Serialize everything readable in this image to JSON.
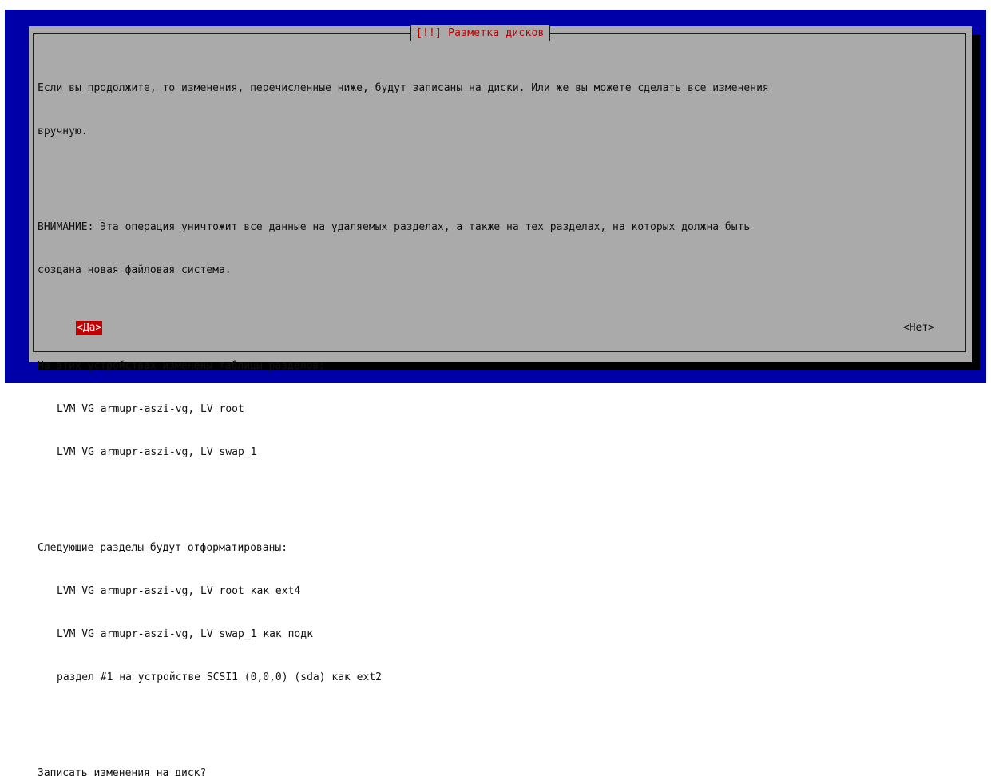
{
  "dialog": {
    "title": "[!!] Разметка дисков",
    "intro_lines": [
      "Если вы продолжите, то изменения, перечисленные ниже, будут записаны на диски. Или же вы можете сделать все изменения",
      "вручную."
    ],
    "warning_lines": [
      "ВНИМАНИЕ: Эта операция уничтожит все данные на удаляемых разделах, а также на тех разделах, на которых должна быть",
      "создана новая файловая система."
    ],
    "tables_changed": {
      "heading": "На этих устройствах изменены таблицы разделов:",
      "items": [
        "LVM VG armupr-aszi-vg, LV root",
        "LVM VG armupr-aszi-vg, LV swap_1"
      ]
    },
    "to_format": {
      "heading": "Следующие разделы будут отформатированы:",
      "items": [
        "LVM VG armupr-aszi-vg, LV root как ext4",
        "LVM VG armupr-aszi-vg, LV swap_1 как подк",
        "раздел #1 на устройстве SCSI1 (0,0,0) (sda) как ext2"
      ]
    },
    "question": "Записать изменения на диск?",
    "yes_label": "<Да>",
    "no_label": "<Нет>"
  },
  "colors": {
    "background": "#0000a8",
    "dialog": "#aaaaaa",
    "title": "#c00000",
    "selected_button": "#c00000"
  }
}
